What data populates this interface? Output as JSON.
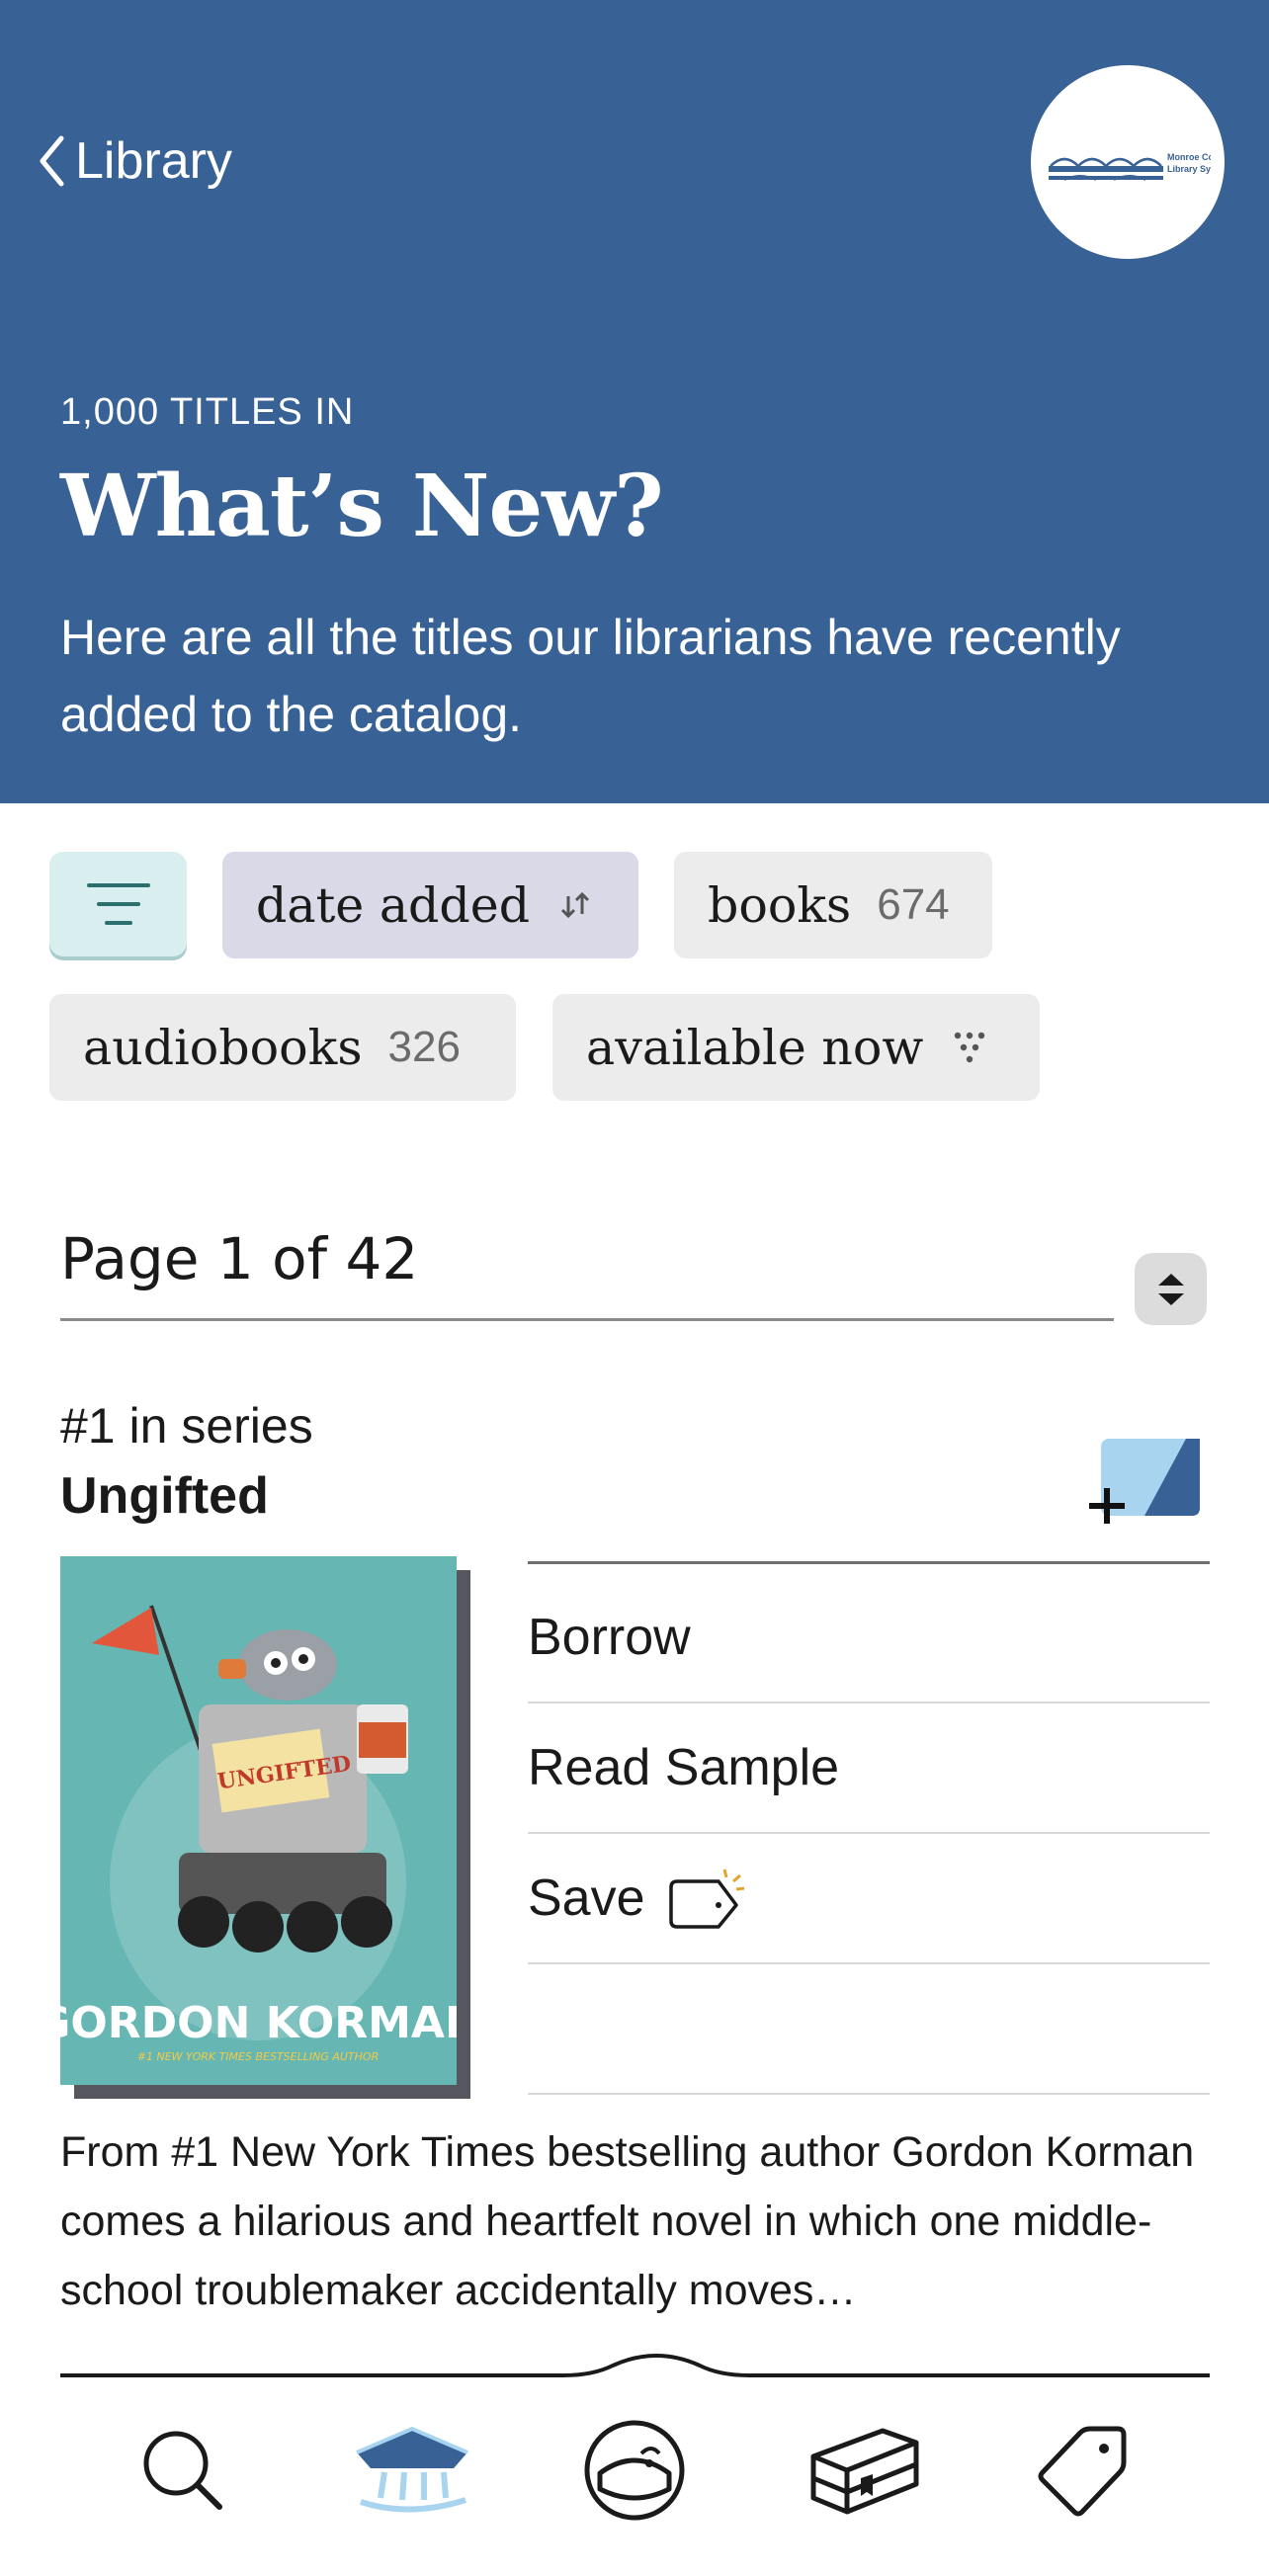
{
  "header": {
    "back_label": "Library",
    "logo_alt": "Monroe County Library System",
    "eyebrow": "1,000 TITLES IN",
    "title": "What’s New?",
    "description": "Here are all the titles our librarians have recently added to the catalog."
  },
  "filters": {
    "menu_icon": "hamburger-icon",
    "chips": [
      {
        "label": "date added",
        "icon": "sort-arrows-icon"
      },
      {
        "label": "books",
        "count": "674"
      },
      {
        "label": "audiobooks",
        "count": "326"
      },
      {
        "label": "available now",
        "icon": "filter-funnel-icon"
      }
    ]
  },
  "pagination": {
    "label": "Page 1 of 42",
    "icon": "up-down-stepper-icon"
  },
  "book": {
    "series": "#1 in series",
    "title": "Ungifted",
    "cover": {
      "title": "UNGIFTED",
      "author": "GORDON KORMAN",
      "tagline": "#1 NEW YORK TIMES BESTSELLING AUTHOR"
    },
    "actions": {
      "borrow": "Borrow",
      "sample": "Read Sample",
      "save": "Save"
    },
    "blurb": "From #1 New York Times bestselling author Gordon Korman comes a hilarious and heartfelt novel in which one middle-school troublemaker accidentally moves…"
  },
  "nav": {
    "items": [
      "search-icon",
      "library-icon",
      "guide-icon",
      "shelf-icon",
      "tags-icon"
    ]
  },
  "colors": {
    "header_bg": "#386295",
    "date_chip_bg": "#d9d9e8",
    "menu_chip_bg": "#d9eeee",
    "cover_bg": "#66b6b3",
    "accent_blue": "#386295"
  }
}
